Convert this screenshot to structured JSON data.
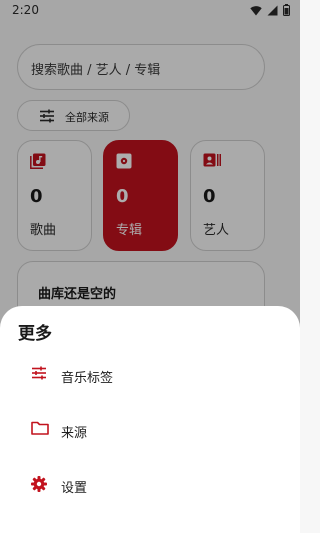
{
  "status_bar": {
    "time": "2:20"
  },
  "search": {
    "placeholder": "搜索歌曲 / 艺人 / 专辑"
  },
  "filter_chip": {
    "label": "全部来源"
  },
  "stats": [
    {
      "count": "0",
      "label": "歌曲",
      "icon": "music-library-icon"
    },
    {
      "count": "0",
      "label": "专辑",
      "icon": "album-disc-icon"
    },
    {
      "count": "0",
      "label": "艺人",
      "icon": "artist-icon"
    }
  ],
  "library": {
    "empty_title": "曲库还是空的"
  },
  "sheet": {
    "title": "更多",
    "items": [
      {
        "label": "音乐标签",
        "icon": "tune-sliders-icon"
      },
      {
        "label": "来源",
        "icon": "folder-icon"
      },
      {
        "label": "设置",
        "icon": "gear-icon"
      }
    ]
  },
  "colors": {
    "accent": "#c2131e",
    "scrim": "rgba(0,0,0,0.32)"
  }
}
